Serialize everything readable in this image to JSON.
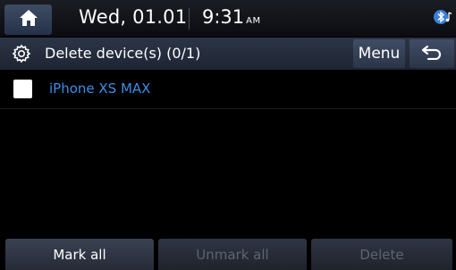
{
  "statusbar": {
    "home_icon": "home-icon",
    "date": "Wed, 01.01",
    "time": "9:31",
    "ampm": "AM",
    "bluetooth_icon": "bluetooth-audio-icon"
  },
  "titlebar": {
    "settings_icon": "gear-icon",
    "title": "Delete device(s) (0/1)",
    "menu_label": "Menu",
    "back_icon": "back-arrow-icon"
  },
  "devices": [
    {
      "name": "iPhone XS MAX",
      "checked": false
    }
  ],
  "bottom_buttons": {
    "mark_all": "Mark all",
    "unmark_all": "Unmark all",
    "delete": "Delete"
  },
  "colors": {
    "device_name": "#3b8ee8",
    "background": "#000000",
    "disabled_text": "#5e6471"
  }
}
